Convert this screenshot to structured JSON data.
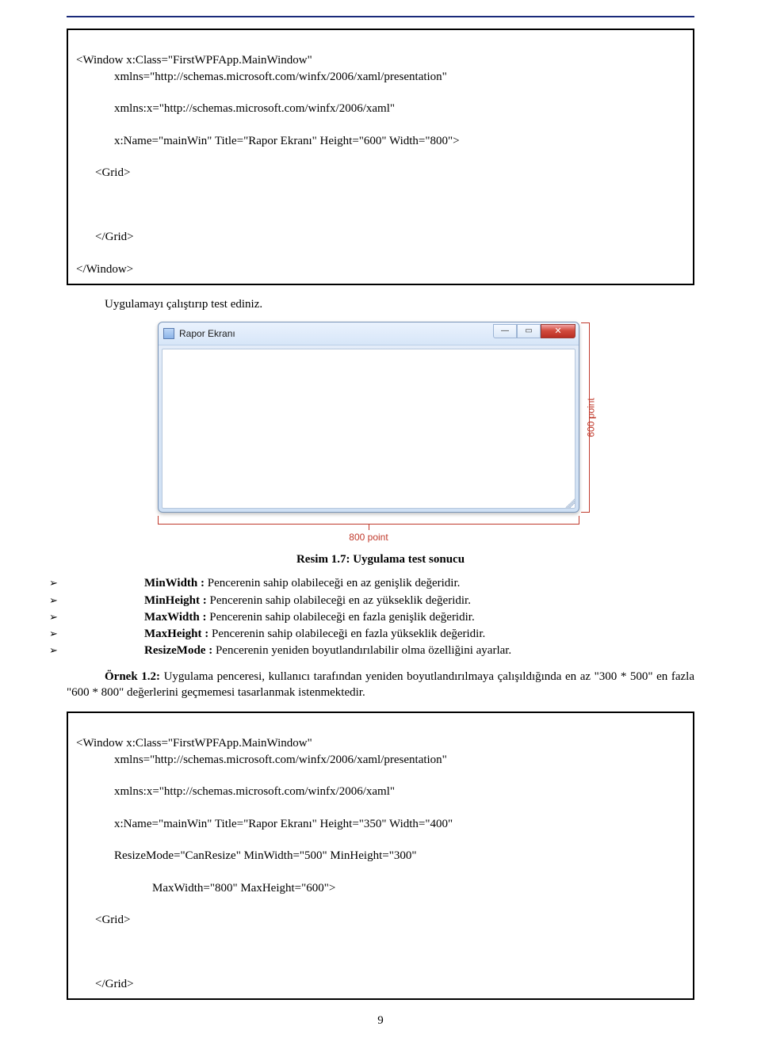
{
  "codebox1": {
    "l1": "<Window x:Class=\"FirstWPFApp.MainWindow\"",
    "l2": "xmlns=\"http://schemas.microsoft.com/winfx/2006/xaml/presentation\"",
    "l3": "xmlns:x=\"http://schemas.microsoft.com/winfx/2006/xaml\"",
    "l4": "x:Name=\"mainWin\" Title=\"Rapor Ekranı\" Height=\"600\" Width=\"800\">",
    "l5": "<Grid>",
    "l6": "</Grid>",
    "l7": "</Window>"
  },
  "para1": "Uygulamayı çalıştırıp test ediniz.",
  "window": {
    "title": "Rapor Ekranı",
    "min": "—",
    "max": "▭",
    "close": "✕",
    "bottom_label": "800 point",
    "right_label": "600 point"
  },
  "caption": "Resim 1.7: Uygulama test sonucu",
  "bullets": [
    {
      "name": "MinWidth : ",
      "desc": "Pencerenin sahip olabileceği en az genişlik değeridir."
    },
    {
      "name": "MinHeight : ",
      "desc": "Pencerenin sahip olabileceği en az yükseklik değeridir."
    },
    {
      "name": "MaxWidth : ",
      "desc": "Pencerenin sahip olabileceği en fazla genişlik değeridir."
    },
    {
      "name": "MaxHeight : ",
      "desc": "Pencerenin sahip olabileceği en fazla yükseklik değeridir."
    },
    {
      "name": "ResizeMode : ",
      "desc": "Pencerenin yeniden boyutlandırılabilir olma özelliğini ayarlar."
    }
  ],
  "example": {
    "label": "Örnek 1.2: ",
    "text": "Uygulama penceresi, kullanıcı tarafından yeniden boyutlandırılmaya çalışıldığında en az \"300 * 500\" en fazla \"600 * 800\" değerlerini geçmemesi tasarlanmak istenmektedir."
  },
  "codebox2": {
    "l1": "<Window x:Class=\"FirstWPFApp.MainWindow\"",
    "l2": "xmlns=\"http://schemas.microsoft.com/winfx/2006/xaml/presentation\"",
    "l3": "xmlns:x=\"http://schemas.microsoft.com/winfx/2006/xaml\"",
    "l4": "x:Name=\"mainWin\" Title=\"Rapor Ekranı\" Height=\"350\" Width=\"400\"",
    "l5": "ResizeMode=\"CanResize\" MinWidth=\"500\" MinHeight=\"300\"",
    "l6": "MaxWidth=\"800\" MaxHeight=\"600\">",
    "l7": "<Grid>",
    "l8": "</Grid>"
  },
  "pagenum": "9"
}
